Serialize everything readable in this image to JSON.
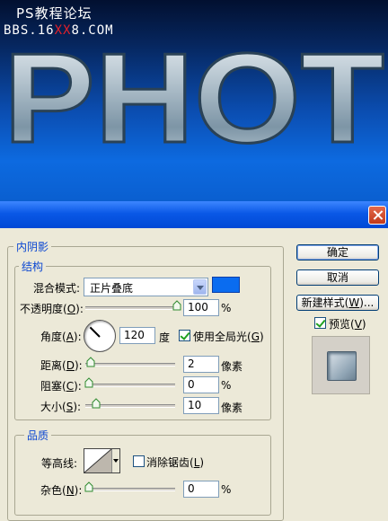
{
  "banner": {
    "watermark_line1": "PS教程论坛",
    "watermark_line2_prefix": "BBS.16",
    "watermark_line2_red": "XX",
    "watermark_line2_suffix": "8.COM",
    "headline": "PHOT"
  },
  "dialog": {
    "group_title": "内阴影",
    "structure": {
      "title": "结构",
      "blend_mode_label": "混合模式:",
      "blend_mode_value": "正片叠底",
      "blend_color": "#0a6cf0",
      "opacity_label_pre": "不透明度(",
      "opacity_key": "O",
      "opacity_label_post": "):",
      "opacity_value": "100",
      "opacity_unit": "%",
      "angle_label_pre": "角度(",
      "angle_key": "A",
      "angle_label_post": "):",
      "angle_value": "120",
      "angle_unit": "度",
      "global_light_pre": "使用全局光(",
      "global_light_key": "G",
      "global_light_post": ")",
      "global_light_checked": true,
      "distance_label_pre": "距离(",
      "distance_key": "D",
      "distance_label_post": "):",
      "distance_value": "2",
      "distance_unit": "像素",
      "choke_label_pre": "阻塞(",
      "choke_key": "C",
      "choke_label_post": "):",
      "choke_value": "0",
      "choke_unit": "%",
      "size_label_pre": "大小(",
      "size_key": "S",
      "size_label_post": "):",
      "size_value": "10",
      "size_unit": "像素"
    },
    "quality": {
      "title": "品质",
      "contour_label": "等高线:",
      "antialias_pre": "消除锯齿(",
      "antialias_key": "L",
      "antialias_post": ")",
      "antialias_checked": false,
      "noise_label_pre": "杂色(",
      "noise_key": "N",
      "noise_label_post": "):",
      "noise_value": "0",
      "noise_unit": "%"
    },
    "buttons": {
      "ok": "确定",
      "cancel": "取消",
      "new_style_pre": "新建样式(",
      "new_style_key": "W",
      "new_style_post": ")...",
      "preview_pre": "预览(",
      "preview_key": "V",
      "preview_post": ")",
      "preview_checked": true
    }
  }
}
